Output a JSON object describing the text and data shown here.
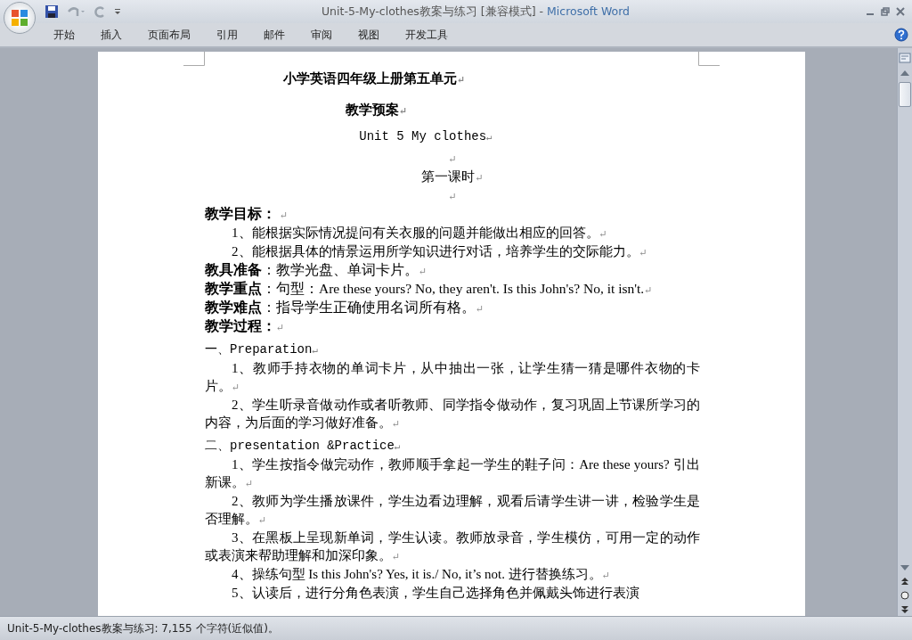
{
  "window": {
    "title": "Unit-5-My-clothes教案与练习 [兼容模式] -",
    "app_name": "Microsoft Word"
  },
  "ribbon_tabs": [
    {
      "label": "开始"
    },
    {
      "label": "插入"
    },
    {
      "label": "页面布局"
    },
    {
      "label": "引用"
    },
    {
      "label": "邮件"
    },
    {
      "label": "审阅"
    },
    {
      "label": "视图"
    },
    {
      "label": "开发工具"
    }
  ],
  "document": {
    "paragraphs": [
      {
        "kind": "title",
        "text": "小学英语四年级上册第五单元",
        "mark": "↵"
      },
      {
        "kind": "subtitle",
        "text": "教学预案",
        "mark": "↵"
      },
      {
        "kind": "center-mono",
        "text": "Unit 5 My clothes",
        "mark": "↵"
      },
      {
        "kind": "center",
        "mark": "↵"
      },
      {
        "kind": "center",
        "text": "第一课时",
        "mark": "↵"
      },
      {
        "kind": "center",
        "mark": "↵"
      },
      {
        "kind": "label",
        "text": "**教学目标：** ",
        "mark": "↵"
      },
      {
        "kind": "item",
        "text": "1、能根据实际情况提问有关衣服的问题并能做出相应的回答。",
        "mark": "↵"
      },
      {
        "kind": "item",
        "text": "2、能根据具体的情景运用所学知识进行对话，培养学生的交际能力。",
        "mark": "↵"
      },
      {
        "kind": "label",
        "text": "**教具准备**：教学光盘、单词卡片。",
        "mark": "↵"
      },
      {
        "kind": "label",
        "text": "**教学重点**：句型：Are these yours? No, they aren't. Is this John's? No, it isn't.",
        "mark": "↵"
      },
      {
        "kind": "label",
        "text": "**教学难点**：指导学生正确使用名词所有格。",
        "mark": "↵"
      },
      {
        "kind": "label",
        "text": "**教学过程：**",
        "mark": "↵"
      },
      {
        "kind": "section",
        "text": "一、Preparation",
        "mark": "↵"
      },
      {
        "kind": "item",
        "text": "1、教师手持衣物的单词卡片，从中抽出一张，让学生猜一猜是哪件衣物的卡片。",
        "mark": "↵"
      },
      {
        "kind": "item",
        "text": "2、学生听录音做动作或者听教师、同学指令做动作，复习巩固上节课所学习的内容，为后面的学习做好准备。",
        "mark": "↵"
      },
      {
        "kind": "section",
        "text": "二、presentation &Practice",
        "mark": "↵"
      },
      {
        "kind": "item",
        "text": "1、学生按指令做完动作，教师顺手拿起一学生的鞋子问：Are these yours? 引出新课。",
        "mark": "↵"
      },
      {
        "kind": "item",
        "text": "2、教师为学生播放课件，学生边看边理解，观看后请学生讲一讲，检验学生是否理解。",
        "mark": "↵"
      },
      {
        "kind": "item",
        "text": "3、在黑板上呈现新单词，学生认读。教师放录音，学生模仿，可用一定的动作或表演来帮助理解和加深印象。",
        "mark": "↵"
      },
      {
        "kind": "item",
        "text": "4、操练句型 Is this John's? Yes, it is./ No, it’s not. 进行替换练习。",
        "mark": "↵"
      },
      {
        "kind": "item",
        "text": "5、认读后，进行分角色表演，学生自己选择角色并佩戴头饰进行表演"
      }
    ]
  },
  "status_bar": {
    "text": "Unit-5-My-clothes教案与练习: 7,155 个字符(近似值)。"
  }
}
